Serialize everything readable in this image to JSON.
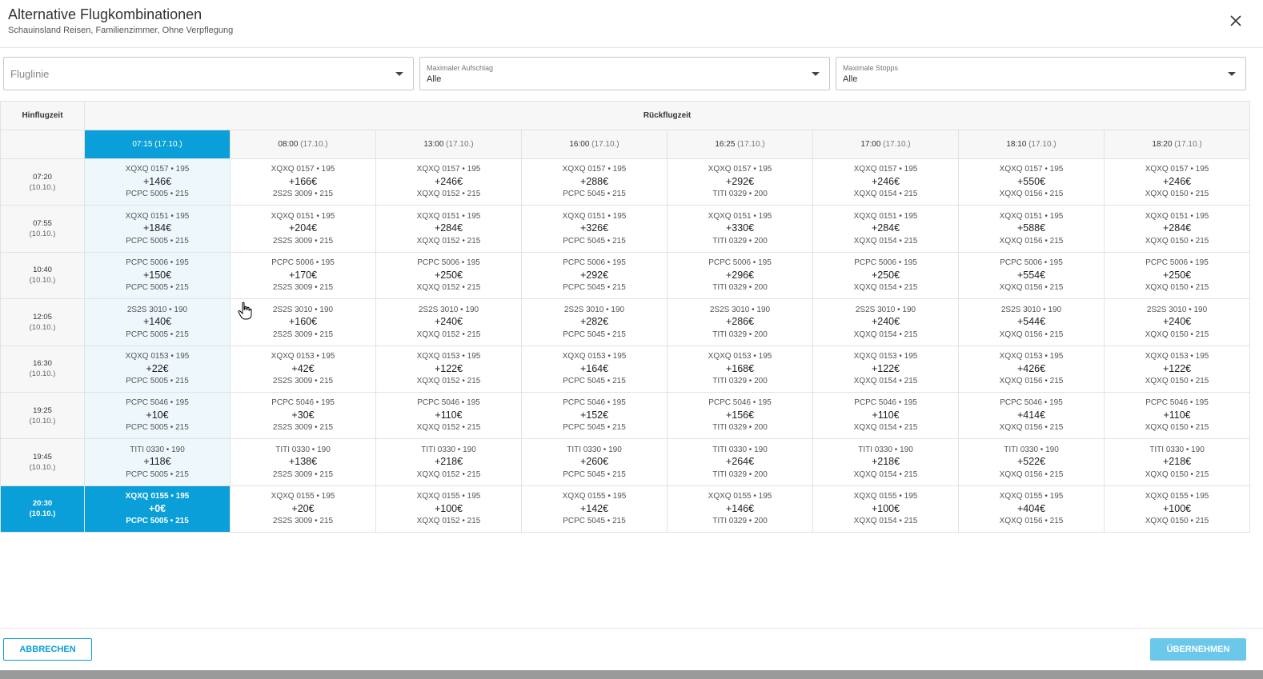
{
  "dialog": {
    "title": "Alternative Flugkombinationen",
    "subtitle": "Schauinsland Reisen, Familienzimmer, Ohne Verpflegung"
  },
  "filters": {
    "airline": {
      "placeholder": "Fluglinie"
    },
    "surcharge": {
      "label": "Maximaler Aufschlag",
      "value": "Alle"
    },
    "stops": {
      "label": "Maximale Stopps",
      "value": "Alle"
    }
  },
  "grid": {
    "outbound_header": "Hinflugzeit",
    "return_header": "Rückflugzeit",
    "columns": [
      {
        "time": "07:15",
        "date": "(17.10.)",
        "return": "PCPC 5005 • 215"
      },
      {
        "time": "08:00",
        "date": "(17.10.)",
        "return": "2S2S 3009 • 215"
      },
      {
        "time": "13:00",
        "date": "(17.10.)",
        "return": "XQXQ 0152 • 215"
      },
      {
        "time": "16:00",
        "date": "(17.10.)",
        "return": "PCPC 5045 • 215"
      },
      {
        "time": "16:25",
        "date": "(17.10.)",
        "return": "TITI 0329 • 200"
      },
      {
        "time": "17:00",
        "date": "(17.10.)",
        "return": "XQXQ 0154 • 215"
      },
      {
        "time": "18:10",
        "date": "(17.10.)",
        "return": "XQXQ 0156 • 215"
      },
      {
        "time": "18:20",
        "date": "(17.10.)",
        "return": "XQXQ 0150 • 215"
      }
    ],
    "rows": [
      {
        "time": "07:20",
        "date": "(10.10.)",
        "outbound": "XQXQ 0157 • 195",
        "prices": [
          "+146€",
          "+166€",
          "+246€",
          "+288€",
          "+292€",
          "+246€",
          "+550€",
          "+246€"
        ]
      },
      {
        "time": "07:55",
        "date": "(10.10.)",
        "outbound": "XQXQ 0151 • 195",
        "prices": [
          "+184€",
          "+204€",
          "+284€",
          "+326€",
          "+330€",
          "+284€",
          "+588€",
          "+284€"
        ]
      },
      {
        "time": "10:40",
        "date": "(10.10.)",
        "outbound": "PCPC 5006 • 195",
        "prices": [
          "+150€",
          "+170€",
          "+250€",
          "+292€",
          "+296€",
          "+250€",
          "+554€",
          "+250€"
        ]
      },
      {
        "time": "12:05",
        "date": "(10.10.)",
        "outbound": "2S2S 3010 • 190",
        "prices": [
          "+140€",
          "+160€",
          "+240€",
          "+282€",
          "+286€",
          "+240€",
          "+544€",
          "+240€"
        ]
      },
      {
        "time": "16:30",
        "date": "(10.10.)",
        "outbound": "XQXQ 0153 • 195",
        "prices": [
          "+22€",
          "+42€",
          "+122€",
          "+164€",
          "+168€",
          "+122€",
          "+426€",
          "+122€"
        ]
      },
      {
        "time": "19:25",
        "date": "(10.10.)",
        "outbound": "PCPC 5046 • 195",
        "prices": [
          "+10€",
          "+30€",
          "+110€",
          "+152€",
          "+156€",
          "+110€",
          "+414€",
          "+110€"
        ]
      },
      {
        "time": "19:45",
        "date": "(10.10.)",
        "outbound": "TITI 0330 • 190",
        "prices": [
          "+118€",
          "+138€",
          "+218€",
          "+260€",
          "+264€",
          "+218€",
          "+522€",
          "+218€"
        ]
      },
      {
        "time": "20:30",
        "date": "(10.10.)",
        "outbound": "XQXQ 0155 • 195",
        "prices": [
          "+0€",
          "+20€",
          "+100€",
          "+142€",
          "+146€",
          "+100€",
          "+404€",
          "+100€"
        ]
      }
    ],
    "selected": {
      "row": 7,
      "col": 0
    }
  },
  "footer": {
    "cancel_label": "ABBRECHEN",
    "apply_label": "ÜBERNEHMEN"
  },
  "colors": {
    "accent": "#0a9fd8",
    "apply_button": "#6cc8ea",
    "selected_column_tint": "#eef7fb",
    "header_bg": "#f7f7f7"
  },
  "icons": {
    "close": "close-icon",
    "dropdown": "chevron-down-icon",
    "cursor": "hand-pointer-icon"
  }
}
